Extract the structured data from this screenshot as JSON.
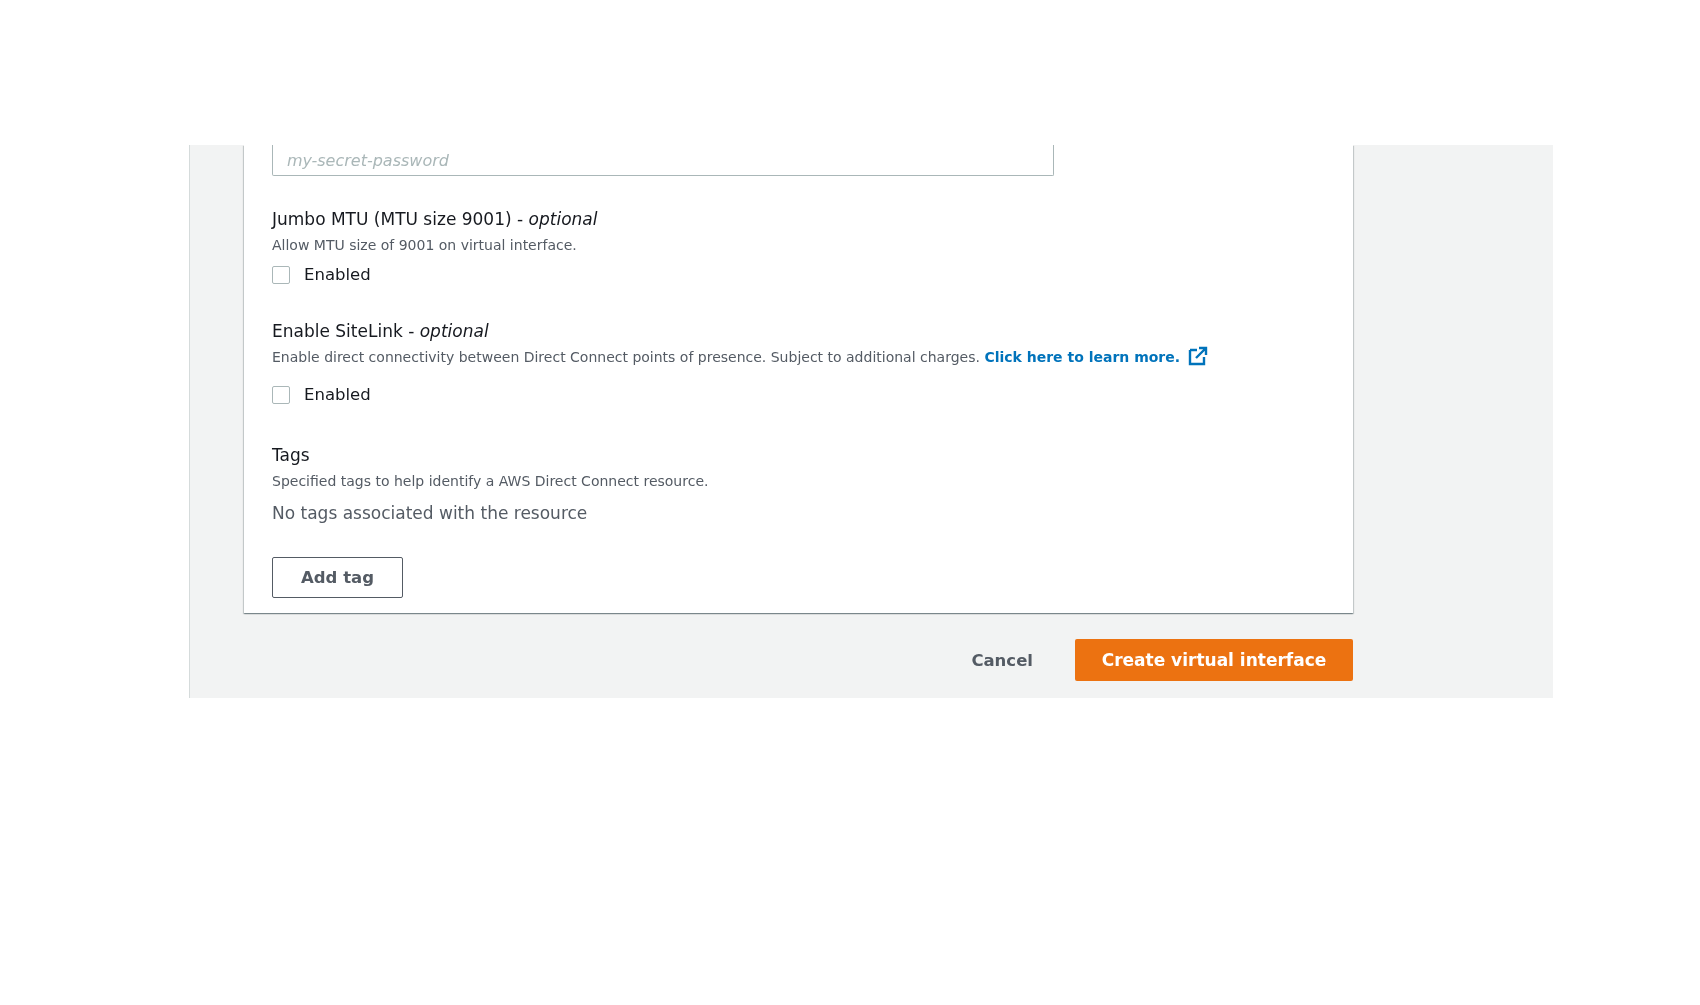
{
  "password_field": {
    "placeholder": "my-secret-password"
  },
  "options": [
    {
      "label": "Jumbo MTU (MTU size 9001) - *optional*",
      "description": "Allow MTU size of 9001 on virtual interface.",
      "checkbox_label": "Enabled",
      "checked": false
    },
    {
      "label": "Enable SiteLink - *optional*",
      "description": "Enable direct connectivity between Direct Connect points of presence. Subject to additional charges.",
      "link": "Click here to learn more.",
      "checkbox_label": "Enabled",
      "checked": false
    }
  ],
  "tags": {
    "label": "Tags",
    "description": "Specified tags to help identify a AWS Direct Connect resource.",
    "empty_text": "No tags associated with the resource",
    "add_button": "Add tag"
  },
  "footer": {
    "cancel": "Cancel",
    "submit": "Create virtual interface"
  }
}
